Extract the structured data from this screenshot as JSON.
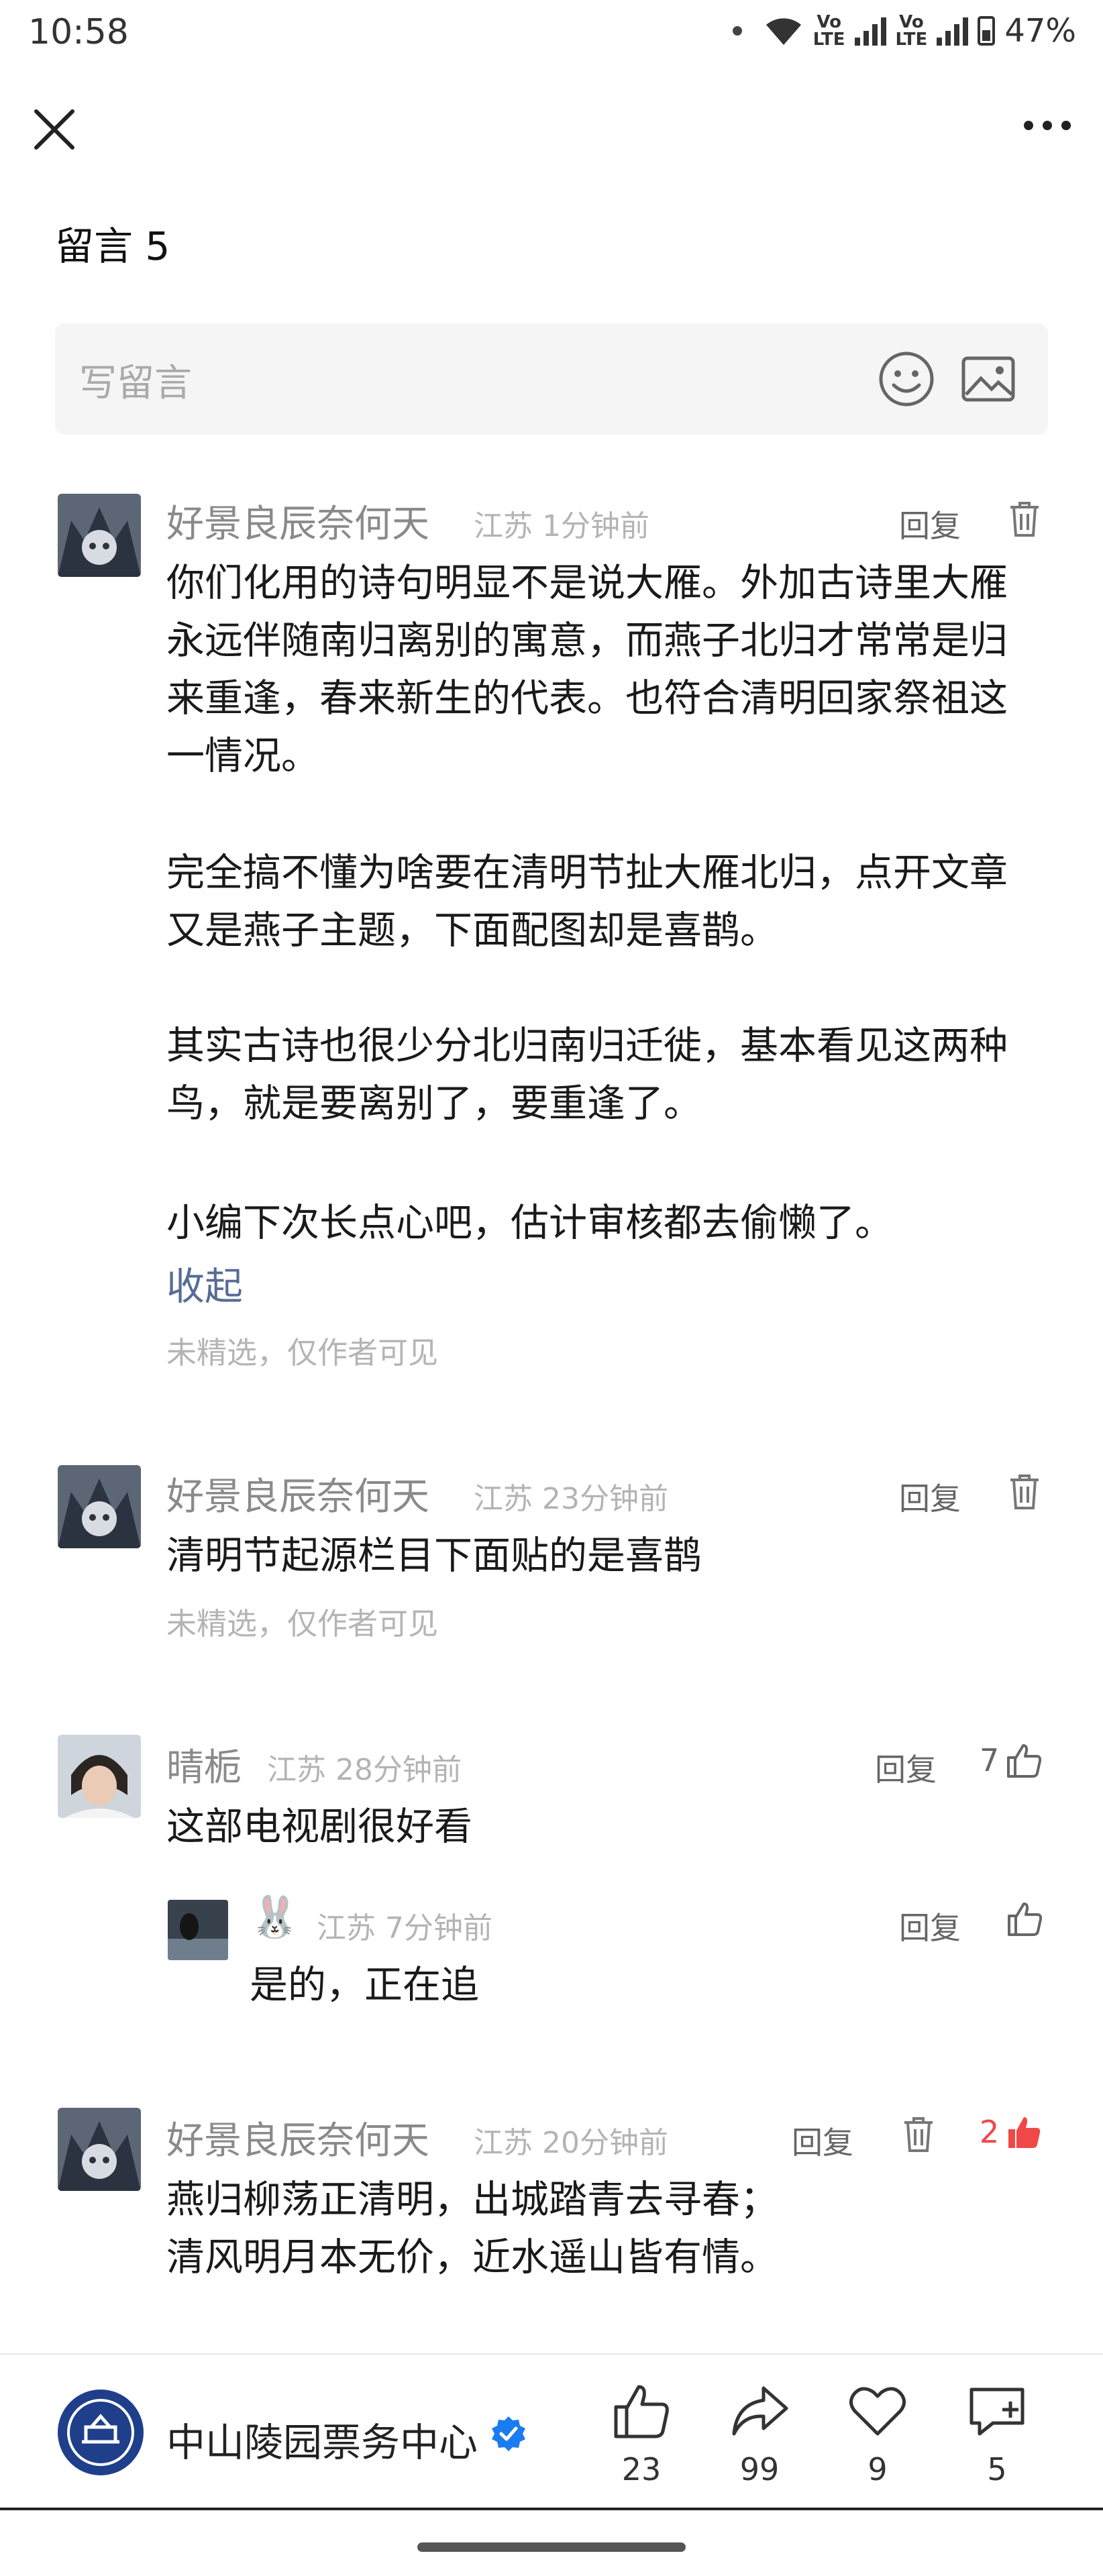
{
  "status_bar": {
    "time": "10:58",
    "battery": "47%",
    "network_label": "LTE",
    "volte_label": "Vo"
  },
  "header": {
    "title": "留言 5"
  },
  "input": {
    "placeholder": "写留言"
  },
  "comments": [
    {
      "name": "好景良辰奈何天",
      "location": "江苏",
      "time": "1分钟前",
      "reply_label": "回复",
      "paragraphs": [
        "你们化用的诗句明显不是说大雁。外加古诗里大雁永远伴随南归离别的寓意，而燕子北归才常常是归来重逢，春来新生的代表。也符合清明回家祭祖这一情况。",
        "完全搞不懂为啥要在清明节扯大雁北归，点开文章又是燕子主题，下面配图却是喜鹊。",
        "其实古诗也很少分北归南归迁徙，基本看见这两种鸟，就是要离别了，要重逢了。",
        "小编下次长点心吧，估计审核都去偷懒了。"
      ],
      "collapse_label": "收起",
      "note": "未精选，仅作者可见"
    },
    {
      "name": "好景良辰奈何天",
      "location": "江苏",
      "time": "23分钟前",
      "reply_label": "回复",
      "text": "清明节起源栏目下面贴的是喜鹊",
      "note": "未精选，仅作者可见"
    },
    {
      "name": "晴栀",
      "location": "江苏",
      "time": "28分钟前",
      "reply_label": "回复",
      "likes": "7",
      "text": "这部电视剧很好看",
      "reply": {
        "name_emoji": "🐰",
        "location": "江苏",
        "time": "7分钟前",
        "reply_label": "回复",
        "text": "是的，正在追"
      }
    },
    {
      "name": "好景良辰奈何天",
      "location": "江苏",
      "time": "20分钟前",
      "reply_label": "回复",
      "likes": "2",
      "lines": [
        "燕归柳荡正清明，出城踏青去寻春；",
        "清风明月本无价，近水遥山皆有情。"
      ]
    }
  ],
  "bottom_bar": {
    "account_name": "中山陵园票务中心",
    "actions": [
      {
        "icon": "thumbs-up-icon",
        "count": "23"
      },
      {
        "icon": "share-icon",
        "count": "99"
      },
      {
        "icon": "heart-icon",
        "count": "9"
      },
      {
        "icon": "comment-add-icon",
        "count": "5"
      }
    ]
  },
  "colors": {
    "link": "#576b95",
    "like_active": "#f04848",
    "verified": "#1a7cf0"
  }
}
